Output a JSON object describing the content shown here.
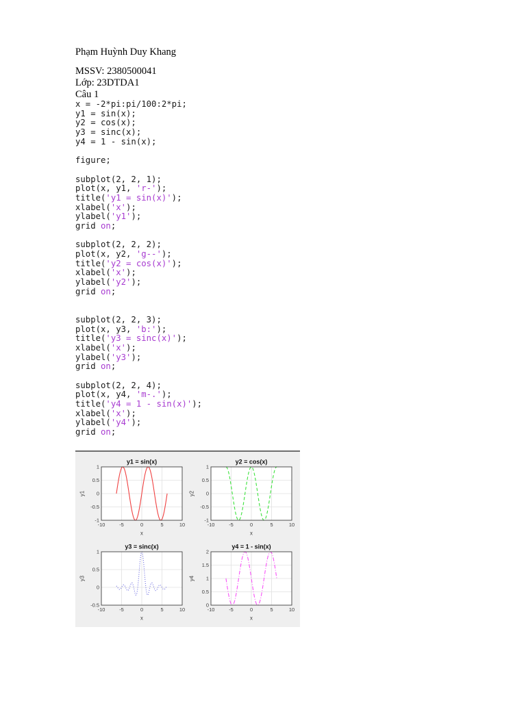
{
  "header": {
    "author": "Phạm Huỳnh Duy Khang",
    "student_id": "MSSV: 2380500041",
    "class_name": "Lớp: 23DTDA1",
    "question": "Câu 1"
  },
  "code": {
    "text_color": "#1a1a1a",
    "string_color": "#a73ad0",
    "lines": [
      [
        [
          "x = -2*pi:pi/100:2*pi;",
          "k"
        ]
      ],
      [
        [
          "y1 = sin(x);",
          "k"
        ]
      ],
      [
        [
          "y2 = cos(x);",
          "k"
        ]
      ],
      [
        [
          "y3 = sinc(x);",
          "k"
        ]
      ],
      [
        [
          "y4 = 1 - sin(x);",
          "k"
        ]
      ],
      [],
      [
        [
          "figure;",
          "k"
        ]
      ],
      [],
      [
        [
          "subplot(2, 2, 1);",
          "k"
        ]
      ],
      [
        [
          "plot(x, y1, ",
          "k"
        ],
        [
          "'r-'",
          "s"
        ],
        [
          ");",
          "k"
        ]
      ],
      [
        [
          "title(",
          "k"
        ],
        [
          "'y1 = sin(x)'",
          "s"
        ],
        [
          ");",
          "k"
        ]
      ],
      [
        [
          "xlabel(",
          "k"
        ],
        [
          "'x'",
          "s"
        ],
        [
          ");",
          "k"
        ]
      ],
      [
        [
          "ylabel(",
          "k"
        ],
        [
          "'y1'",
          "s"
        ],
        [
          ");",
          "k"
        ]
      ],
      [
        [
          "grid ",
          "k"
        ],
        [
          "on",
          "s"
        ],
        [
          ";",
          "k"
        ]
      ],
      [],
      [
        [
          "subplot(2, 2, 2);",
          "k"
        ]
      ],
      [
        [
          "plot(x, y2, ",
          "k"
        ],
        [
          "'g--'",
          "s"
        ],
        [
          ");",
          "k"
        ]
      ],
      [
        [
          "title(",
          "k"
        ],
        [
          "'y2 = cos(x)'",
          "s"
        ],
        [
          ");",
          "k"
        ]
      ],
      [
        [
          "xlabel(",
          "k"
        ],
        [
          "'x'",
          "s"
        ],
        [
          ");",
          "k"
        ]
      ],
      [
        [
          "ylabel(",
          "k"
        ],
        [
          "'y2'",
          "s"
        ],
        [
          ");",
          "k"
        ]
      ],
      [
        [
          "grid ",
          "k"
        ],
        [
          "on",
          "s"
        ],
        [
          ";",
          "k"
        ]
      ],
      [],
      [],
      [
        [
          "subplot(2, 2, 3);",
          "k"
        ]
      ],
      [
        [
          "plot(x, y3, ",
          "k"
        ],
        [
          "'b:'",
          "s"
        ],
        [
          ");",
          "k"
        ]
      ],
      [
        [
          "title(",
          "k"
        ],
        [
          "'y3 = sinc(x)'",
          "s"
        ],
        [
          ");",
          "k"
        ]
      ],
      [
        [
          "xlabel(",
          "k"
        ],
        [
          "'x'",
          "s"
        ],
        [
          ");",
          "k"
        ]
      ],
      [
        [
          "ylabel(",
          "k"
        ],
        [
          "'y3'",
          "s"
        ],
        [
          ");",
          "k"
        ]
      ],
      [
        [
          "grid ",
          "k"
        ],
        [
          "on",
          "s"
        ],
        [
          ";",
          "k"
        ]
      ],
      [],
      [
        [
          "subplot(2, 2, 4);",
          "k"
        ]
      ],
      [
        [
          "plot(x, y4, ",
          "k"
        ],
        [
          "'m-.'",
          "s"
        ],
        [
          ");",
          "k"
        ]
      ],
      [
        [
          "title(",
          "k"
        ],
        [
          "'y4 = 1 - sin(x)'",
          "s"
        ],
        [
          ");",
          "k"
        ]
      ],
      [
        [
          "xlabel(",
          "k"
        ],
        [
          "'x'",
          "s"
        ],
        [
          ");",
          "k"
        ]
      ],
      [
        [
          "ylabel(",
          "k"
        ],
        [
          "'y4'",
          "s"
        ],
        [
          ");",
          "k"
        ]
      ],
      [
        [
          "grid ",
          "k"
        ],
        [
          "on",
          "s"
        ],
        [
          ";",
          "k"
        ]
      ]
    ]
  },
  "figure": {
    "background": "#efefef",
    "top_border_color": "#6e6e6e",
    "grid_color": "#e0e0e0",
    "axis_color": "#404040",
    "tick_color": "#3d3d3d",
    "plot_background": "#ffffff"
  },
  "chart_data": [
    {
      "type": "line",
      "title": "y1 = sin(x)",
      "xlabel": "x",
      "ylabel": "y1",
      "expression": "sin(x)",
      "x_min": -6.2832,
      "x_max": 6.2832,
      "xlim": [
        -10,
        10
      ],
      "ylim": [
        -1,
        1
      ],
      "xticks": [
        -10,
        -5,
        0,
        5,
        10
      ],
      "yticks": [
        -1,
        -0.5,
        0,
        0.5,
        1
      ],
      "line_style": "solid",
      "line_color": "#f04141",
      "grid": true
    },
    {
      "type": "line",
      "title": "y2 = cos(x)",
      "xlabel": "x",
      "ylabel": "y2",
      "expression": "cos(x)",
      "x_min": -6.2832,
      "x_max": 6.2832,
      "xlim": [
        -10,
        10
      ],
      "ylim": [
        -1,
        1
      ],
      "xticks": [
        -10,
        -5,
        0,
        5,
        10
      ],
      "yticks": [
        -1,
        -0.5,
        0,
        0.5,
        1
      ],
      "line_style": "dashed",
      "line_color": "#3ce23c",
      "grid": true
    },
    {
      "type": "line",
      "title": "y3 = sinc(x)",
      "xlabel": "x",
      "ylabel": "y3",
      "expression": "sinc(x)",
      "x_min": -6.2832,
      "x_max": 6.2832,
      "xlim": [
        -10,
        10
      ],
      "ylim": [
        -0.5,
        1
      ],
      "xticks": [
        -10,
        -5,
        0,
        5,
        10
      ],
      "yticks": [
        -0.5,
        0,
        0.5,
        1
      ],
      "line_style": "dotted",
      "line_color": "#6464e0",
      "grid": true
    },
    {
      "type": "line",
      "title": "y4 = 1 - sin(x)",
      "xlabel": "x",
      "ylabel": "y4",
      "expression": "1 - sin(x)",
      "x_min": -6.2832,
      "x_max": 6.2832,
      "xlim": [
        -10,
        10
      ],
      "ylim": [
        0,
        2
      ],
      "xticks": [
        -10,
        -5,
        0,
        5,
        10
      ],
      "yticks": [
        0,
        0.5,
        1,
        1.5,
        2
      ],
      "line_style": "dashdot",
      "line_color": "#f851f8",
      "grid": true
    }
  ]
}
